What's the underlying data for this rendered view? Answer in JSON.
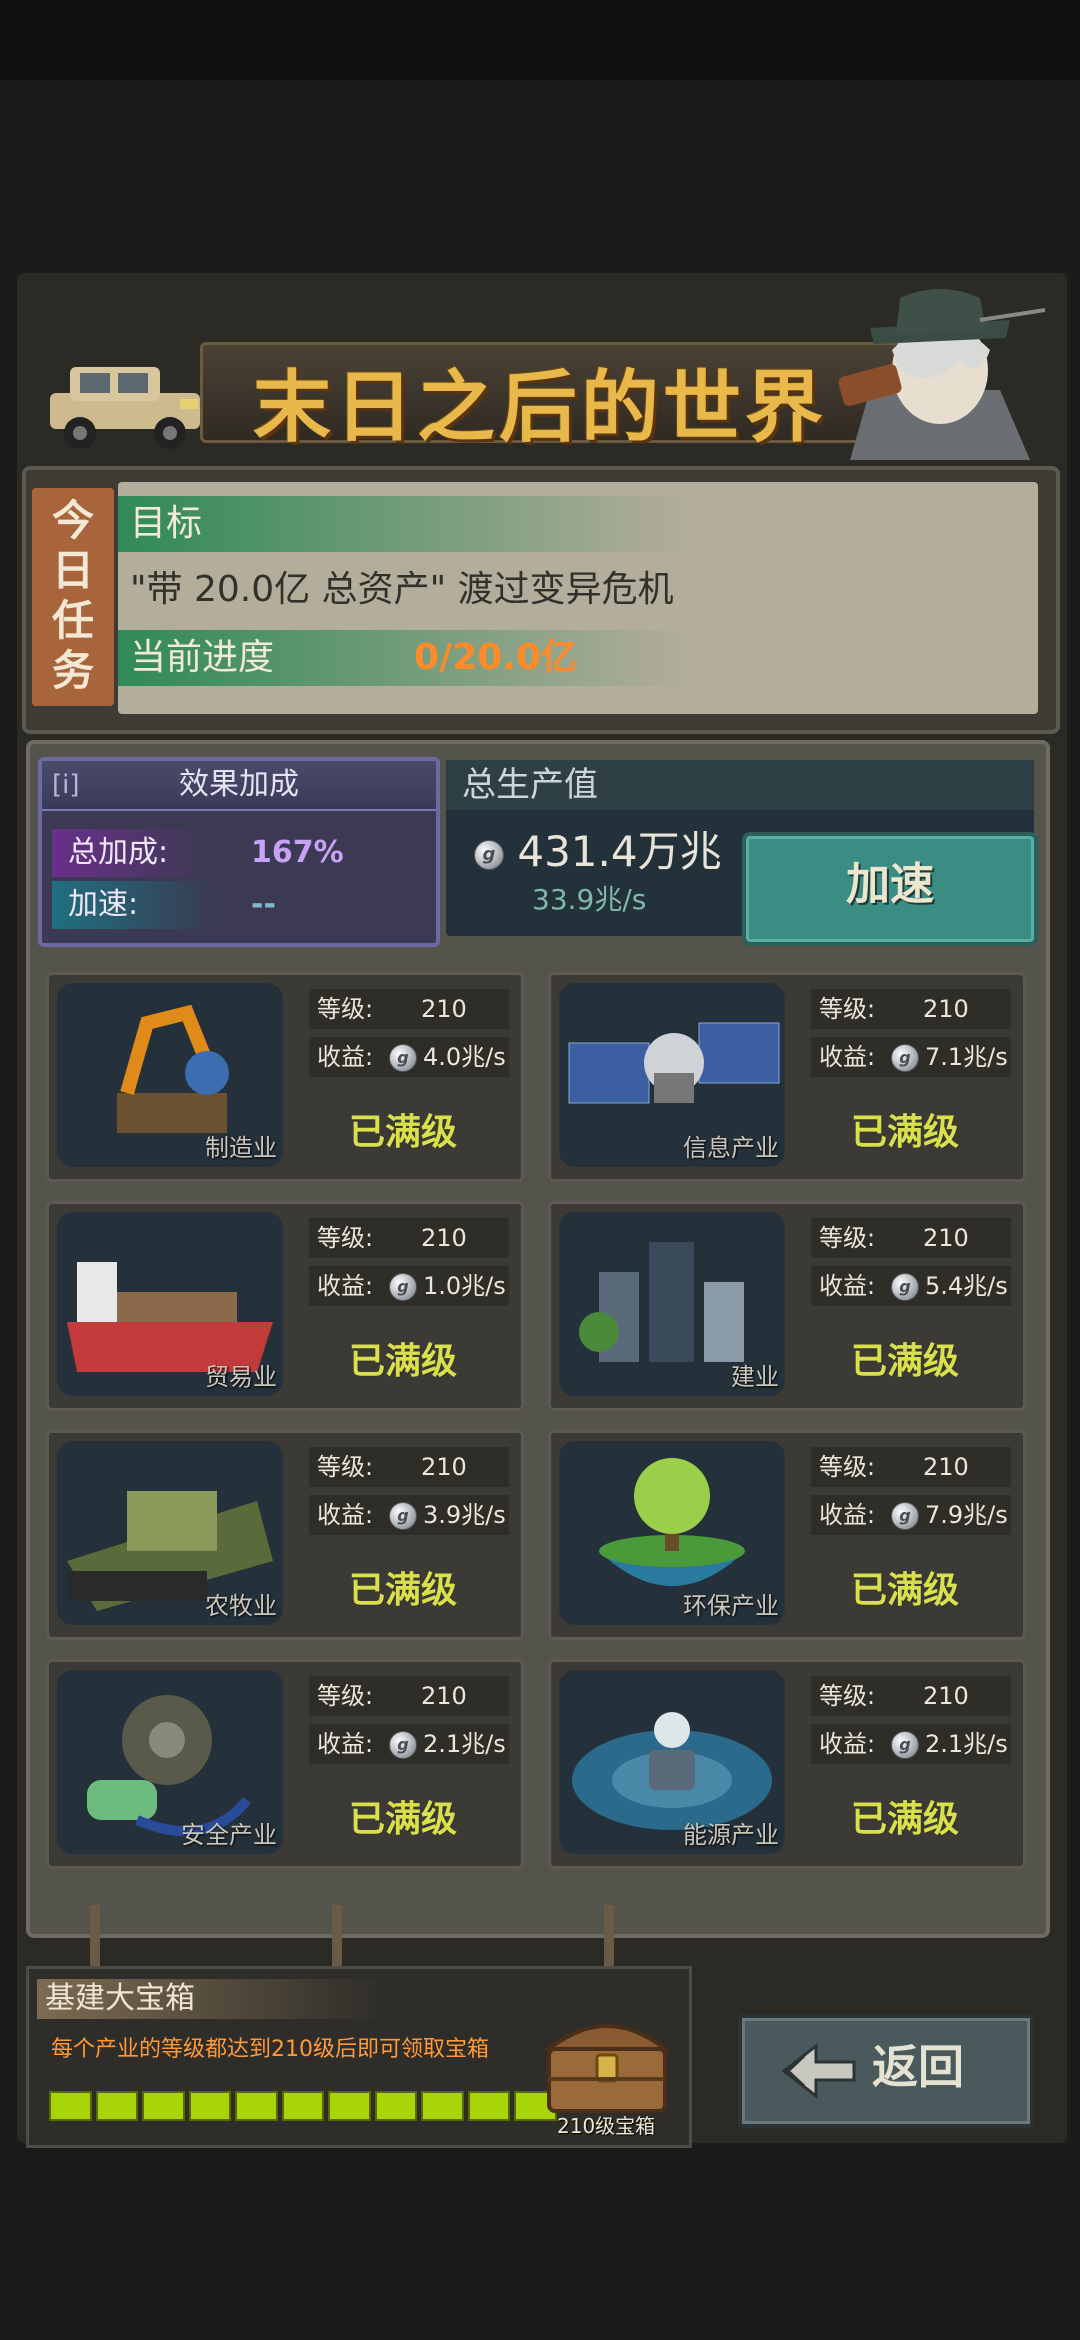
{
  "title": "末日之后的世界",
  "task": {
    "tab_label": "今日任务",
    "goal_label": "目标",
    "goal_text": "\"带  20.0亿  总资产\" 渡过变异危机",
    "progress_label": "当前进度",
    "progress_value": "0/20.0亿"
  },
  "bonus": {
    "info_label": "[i]",
    "title": "效果加成",
    "total_label": "总加成:",
    "total_value": "167%",
    "speed_label": "加速:",
    "speed_value": "--"
  },
  "production": {
    "title": "总生产值",
    "value": "431.4万兆",
    "rate": "33.9兆/s",
    "speed_button": "加速"
  },
  "coin_glyph": "g",
  "industries": [
    {
      "name": "制造业",
      "level_label": "等级:",
      "level": "210",
      "income_label": "收益:",
      "income": "4.0兆/s",
      "status": "已满级"
    },
    {
      "name": "信息产业",
      "level_label": "等级:",
      "level": "210",
      "income_label": "收益:",
      "income": "7.1兆/s",
      "status": "已满级"
    },
    {
      "name": "贸易业",
      "level_label": "等级:",
      "level": "210",
      "income_label": "收益:",
      "income": "1.0兆/s",
      "status": "已满级"
    },
    {
      "name": "建业",
      "level_label": "等级:",
      "level": "210",
      "income_label": "收益:",
      "income": "5.4兆/s",
      "status": "已满级"
    },
    {
      "name": "农牧业",
      "level_label": "等级:",
      "level": "210",
      "income_label": "收益:",
      "income": "3.9兆/s",
      "status": "已满级"
    },
    {
      "name": "环保产业",
      "level_label": "等级:",
      "level": "210",
      "income_label": "收益:",
      "income": "7.9兆/s",
      "status": "已满级"
    },
    {
      "name": "安全产业",
      "level_label": "等级:",
      "level": "210",
      "income_label": "收益:",
      "income": "2.1兆/s",
      "status": "已满级"
    },
    {
      "name": "能源产业",
      "level_label": "等级:",
      "level": "210",
      "income_label": "收益:",
      "income": "2.1兆/s",
      "status": "已满级"
    }
  ],
  "treasure": {
    "title": "基建大宝箱",
    "description": "每个产业的等级都达到210级后即可领取宝箱",
    "progress_segments_filled": 11,
    "progress_segments_total": 11,
    "chest_label": "210级宝箱"
  },
  "back_button": "返回",
  "colors": {
    "accent_gold": "#e8b94a",
    "progress_orange": "#ff8a2a",
    "max_level_yellow": "#d9e04b",
    "bonus_purple": "#c7a2f6",
    "speed_button_teal": "#3b8d84",
    "progress_bar_green": "#a8d40a"
  }
}
